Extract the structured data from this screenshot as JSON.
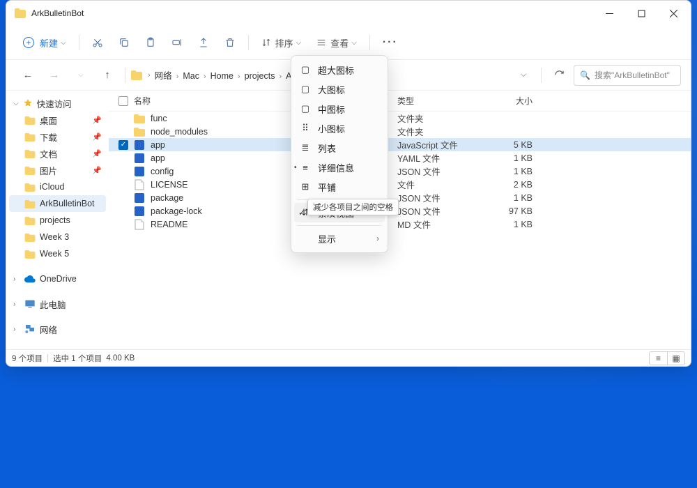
{
  "window": {
    "title": "ArkBulletinBot"
  },
  "toolbar": {
    "new_label": "新建",
    "sort_label": "排序",
    "view_label": "查看"
  },
  "breadcrumbs": [
    "网络",
    "Mac",
    "Home",
    "projects",
    "ArkBulletinBot"
  ],
  "search": {
    "placeholder": "搜索\"ArkBulletinBot\""
  },
  "sidebar": {
    "quick_access_label": "快速访问",
    "items": [
      {
        "label": "桌面",
        "pinned": true
      },
      {
        "label": "下载",
        "pinned": true
      },
      {
        "label": "文档",
        "pinned": true
      },
      {
        "label": "图片",
        "pinned": true
      },
      {
        "label": "iCloud",
        "pinned": false
      },
      {
        "label": "ArkBulletinBot",
        "pinned": false,
        "selected": true
      },
      {
        "label": "projects",
        "pinned": false
      },
      {
        "label": "Week 3",
        "pinned": false
      },
      {
        "label": "Week 5",
        "pinned": false
      }
    ],
    "onedrive_label": "OneDrive",
    "this_pc_label": "此电脑",
    "network_label": "网络"
  },
  "columns": {
    "name": "名称",
    "type": "类型",
    "size": "大小"
  },
  "files": [
    {
      "name": "func",
      "type": "文件夹",
      "size": "",
      "icon": "folder"
    },
    {
      "name": "node_modules",
      "type": "文件夹",
      "size": "",
      "icon": "folder"
    },
    {
      "name": "app",
      "type": "JavaScript 文件",
      "size": "5 KB",
      "icon": "js",
      "selected": true,
      "checked": true
    },
    {
      "name": "app",
      "type": "YAML 文件",
      "size": "1 KB",
      "icon": "js"
    },
    {
      "name": "config",
      "type": "JSON 文件",
      "size": "1 KB",
      "icon": "js"
    },
    {
      "name": "LICENSE",
      "type": "文件",
      "size": "2 KB",
      "icon": "file"
    },
    {
      "name": "package",
      "type": "JSON 文件",
      "size": "1 KB",
      "icon": "js"
    },
    {
      "name": "package-lock",
      "type": "JSON 文件",
      "size": "97 KB",
      "icon": "js"
    },
    {
      "name": "README",
      "type": "MD 文件",
      "size": "1 KB",
      "icon": "file"
    }
  ],
  "menu": {
    "items": [
      {
        "label": "超大图标"
      },
      {
        "label": "大图标"
      },
      {
        "label": "中图标"
      },
      {
        "label": "小图标"
      },
      {
        "label": "列表"
      },
      {
        "label": "详细信息",
        "dot": true
      },
      {
        "label": "平铺"
      },
      {
        "label": "紧凑视图",
        "check": true,
        "hover": true
      }
    ],
    "show_label": "显示",
    "tooltip": "减少各项目之间的空格"
  },
  "status": {
    "count": "9 个项目",
    "selected": "选中 1 个项目",
    "size": "4.00 KB"
  }
}
